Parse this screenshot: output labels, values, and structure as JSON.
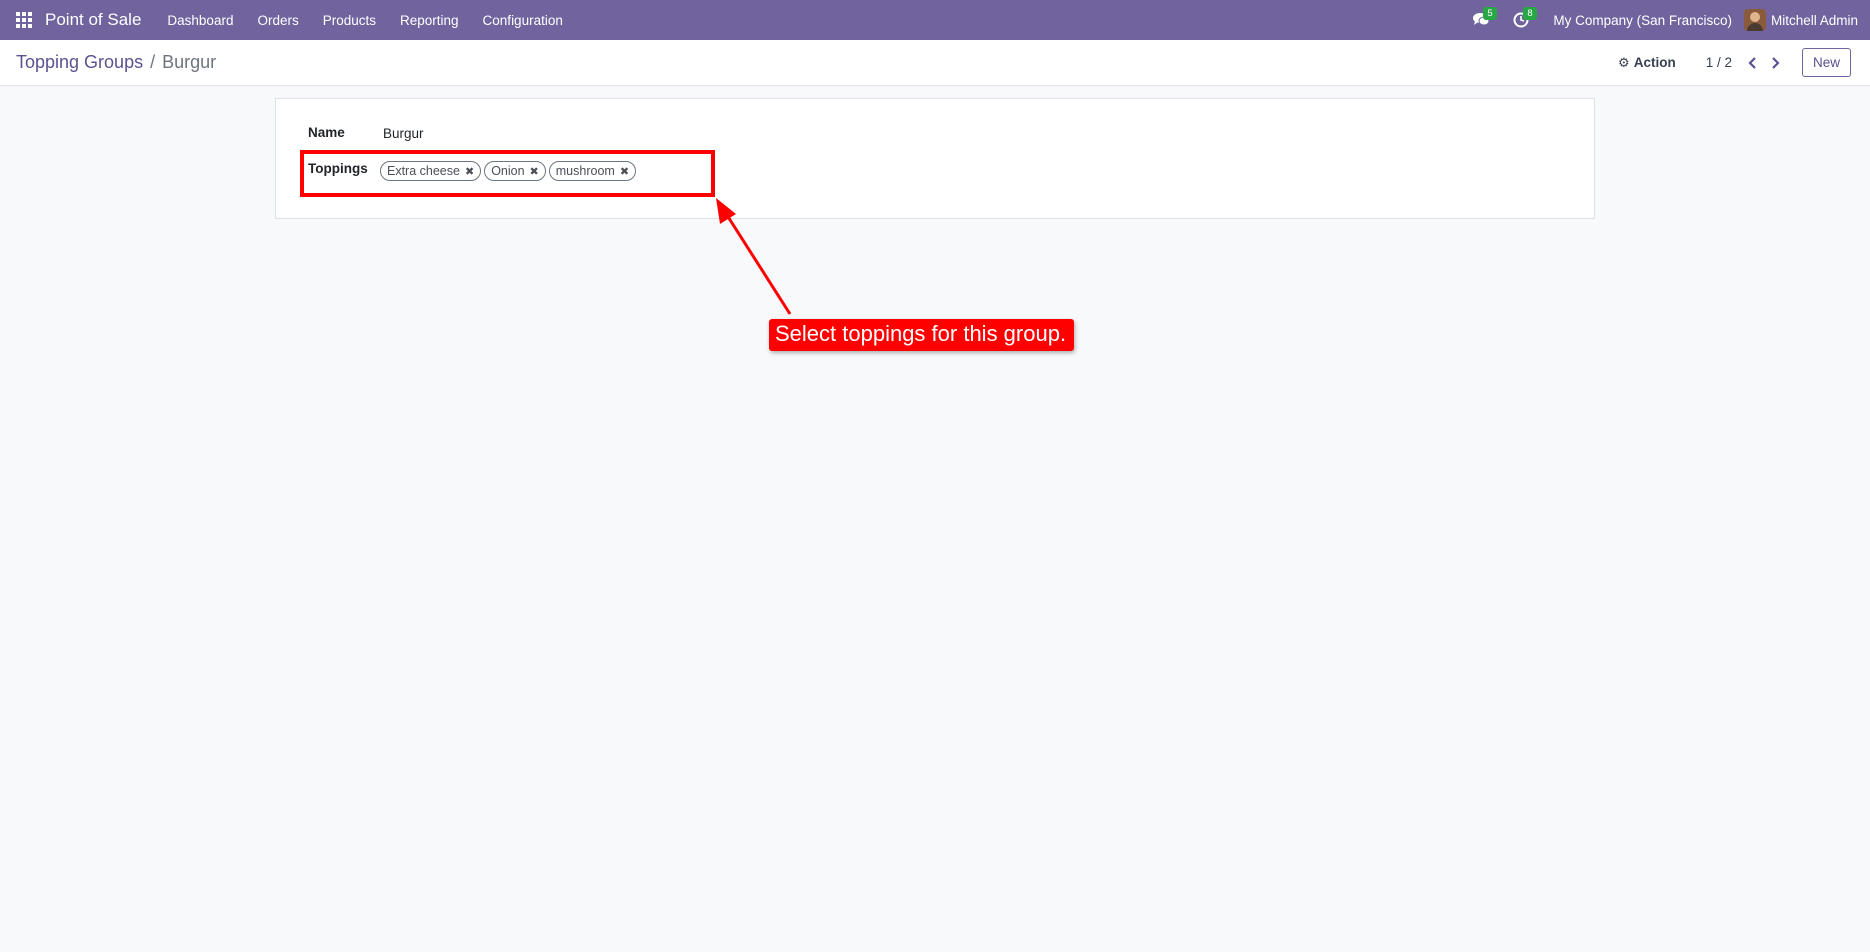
{
  "navbar": {
    "app_name": "Point of Sale",
    "menu": [
      "Dashboard",
      "Orders",
      "Products",
      "Reporting",
      "Configuration"
    ],
    "messages_count": "5",
    "activities_count": "8",
    "company": "My Company (San Francisco)",
    "user": "Mitchell Admin",
    "bg_color": "#71639e"
  },
  "breadcrumb": {
    "parent": "Topping Groups",
    "separator": "/",
    "current": "Burgur"
  },
  "control": {
    "action_label": "Action",
    "pager": "1 / 2",
    "new_label": "New"
  },
  "form": {
    "name_label": "Name",
    "name_value": "Burgur",
    "toppings_label": "Toppings",
    "toppings": [
      "Extra cheese",
      "Onion",
      "mushroom"
    ]
  },
  "annotation": {
    "text": "Select toppings for this group.",
    "color": "#ff0000"
  },
  "icons": {
    "apps": "apps-grid-icon",
    "messages": "chat-icon",
    "activities": "clock-icon",
    "action": "gear-icon",
    "prev": "chevron-left-icon",
    "next": "chevron-right-icon",
    "remove": "close-icon"
  }
}
